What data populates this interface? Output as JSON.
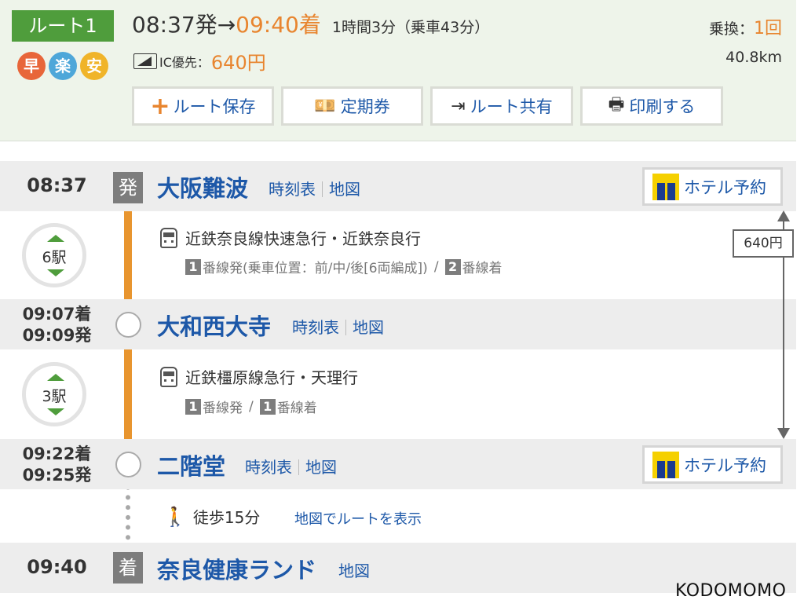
{
  "summary": {
    "route_label": "ルート1",
    "departure": "08:37発",
    "arrow": "→",
    "arrival": "09:40着",
    "duration": "1時間3分（乗車43分）",
    "transfer_label": "乗換：",
    "transfer_count": "1回",
    "distance": "40.8km",
    "marks": [
      "早",
      "楽",
      "安"
    ],
    "ic_label": "IC優先：",
    "ic_fare": "640円",
    "buttons": {
      "save": "ルート保存",
      "commuter": "定期券",
      "share": "ルート共有",
      "print": "印刷する"
    }
  },
  "stations": [
    {
      "time": "08:37",
      "tag": "発",
      "name": "大阪難波",
      "links": [
        "時刻表",
        "地図"
      ],
      "hotel": "ホテル予約"
    },
    {
      "arr": "09:07着",
      "dep": "09:09発",
      "name": "大和西大寺",
      "links": [
        "時刻表",
        "地図"
      ]
    },
    {
      "arr": "09:22着",
      "dep": "09:25発",
      "name": "二階堂",
      "links": [
        "時刻表",
        "地図"
      ],
      "hotel": "ホテル予約"
    },
    {
      "time": "09:40",
      "tag": "着",
      "name": "奈良健康ランド",
      "links": [
        "地図"
      ]
    }
  ],
  "segments": [
    {
      "stops": "6駅",
      "line": "近鉄奈良線快速急行・近鉄奈良行",
      "plat_dep_num": "1",
      "plat_dep_text": "番線発(乗車位置：前/中/後[6両編成])",
      "sep": "/",
      "plat_arr_num": "2",
      "plat_arr_text": "番線着"
    },
    {
      "stops": "3駅",
      "line": "近鉄橿原線急行・天理行",
      "plat_dep_num": "1",
      "plat_dep_text": "番線発",
      "sep": "/",
      "plat_arr_num": "1",
      "plat_arr_text": "番線着"
    }
  ],
  "walk": {
    "text": "徒歩15分",
    "link": "地図でルートを表示"
  },
  "fare_box": "640円",
  "watermark": "KODOMOMO"
}
